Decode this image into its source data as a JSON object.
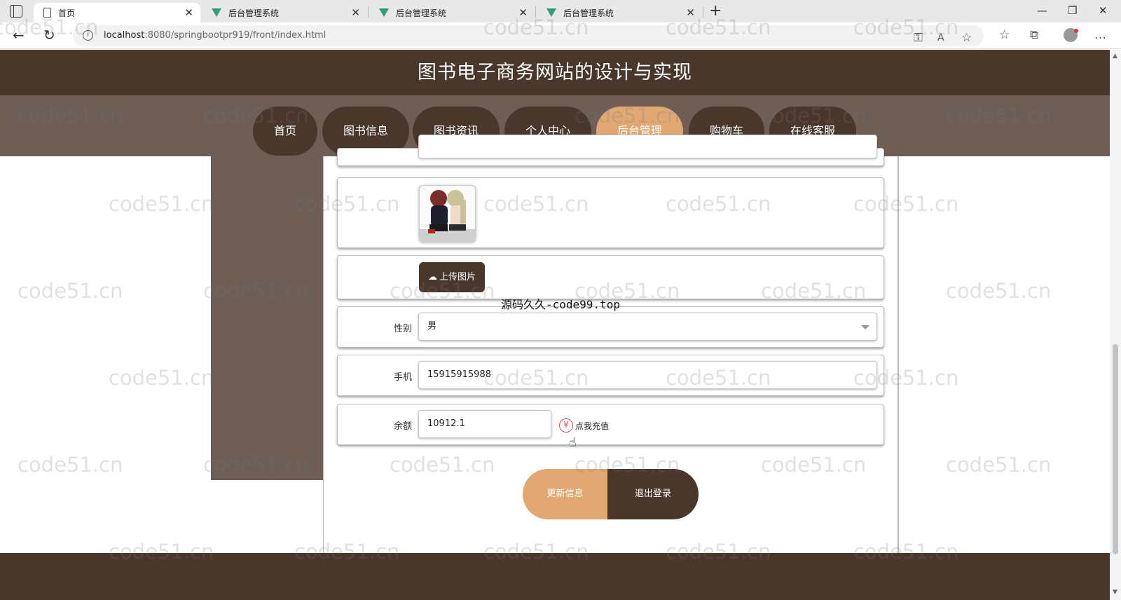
{
  "browser": {
    "tabs": [
      {
        "title": "首页",
        "active": true
      },
      {
        "title": "后台管理系统",
        "active": false
      },
      {
        "title": "后台管理系统",
        "active": false
      },
      {
        "title": "后台管理系统",
        "active": false
      }
    ],
    "url_host": "localhost",
    "url_rest": ":8080/springbootpr919/front/index.html"
  },
  "site": {
    "title": "图书电子商务网站的设计与实现",
    "nav": [
      {
        "label": "首页",
        "active": false
      },
      {
        "label": "图书信息",
        "active": false
      },
      {
        "label": "图书资讯",
        "active": false
      },
      {
        "label": "个人中心",
        "active": false
      },
      {
        "label": "后台管理",
        "active": true
      },
      {
        "label": "购物车",
        "active": false
      },
      {
        "label": "在线客服",
        "active": false
      }
    ]
  },
  "form": {
    "upload_label": "上传图片",
    "gender": {
      "label": "性别",
      "value": "男"
    },
    "phone": {
      "label": "手机",
      "value": "15915915988"
    },
    "balance": {
      "label": "余额",
      "value": "10912.1"
    },
    "recharge_label": "点我充值",
    "update_label": "更新信息",
    "logout_label": "退出登录"
  },
  "overlay_text": "源码久久-code99.top",
  "watermark_text": "code51.cn",
  "icons": {
    "back": "arrow-left-icon",
    "reload": "reload-icon",
    "upload": "cloud-upload-icon",
    "recharge": "yen-icon"
  },
  "colors": {
    "dark_brown": "#4a372c",
    "mid_brown": "#6e5e55",
    "accent": "#e1a873"
  }
}
